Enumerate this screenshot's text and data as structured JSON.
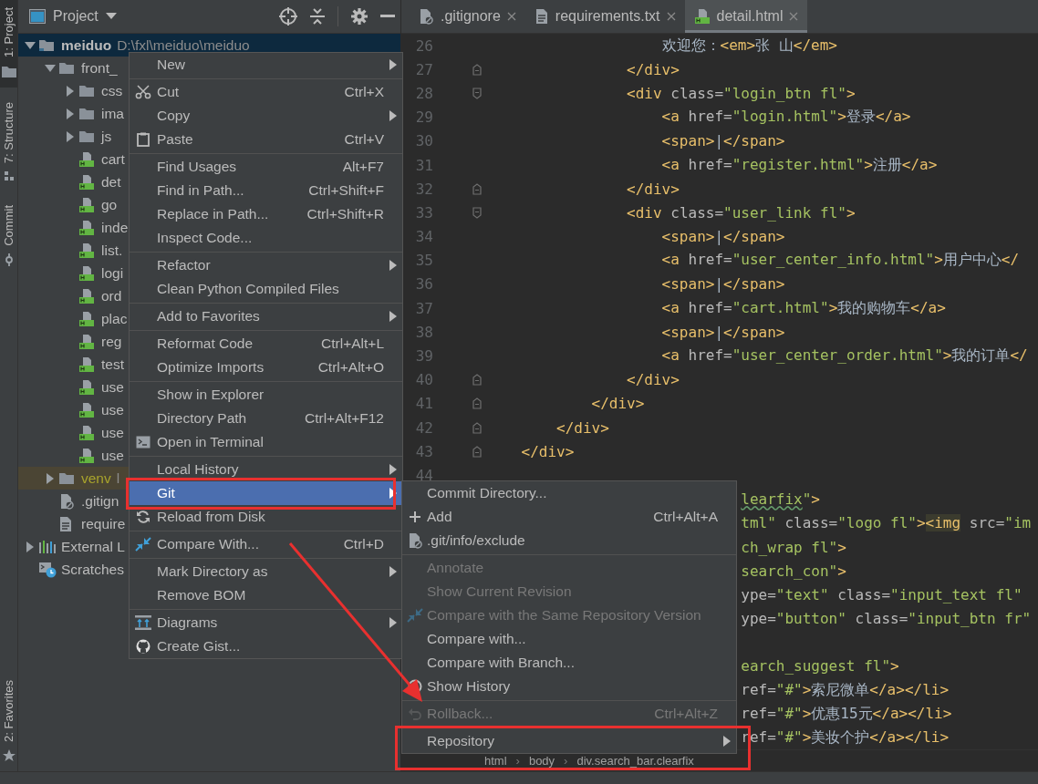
{
  "tool_strip": {
    "top": [
      {
        "label": "1: Project",
        "kind": "folder",
        "selected": true
      },
      {
        "label": "7: Structure",
        "kind": "structure",
        "selected": false
      },
      {
        "label": "Commit",
        "kind": "commit",
        "selected": false
      }
    ],
    "bottom": [
      {
        "label": "2: Favorites",
        "kind": "star",
        "selected": false
      }
    ]
  },
  "project_panel": {
    "title": "Project",
    "tree": [
      {
        "label": "meiduo",
        "path": "D:\\fxl\\meiduo\\meiduo",
        "kind": "module",
        "expanded": true,
        "selected": true,
        "children": [
          {
            "label": "front_",
            "kind": "folder",
            "expanded": true,
            "selected": false,
            "children": [
              {
                "label": "css",
                "kind": "folder",
                "expanded": false,
                "selected": false
              },
              {
                "label": "ima",
                "kind": "folder",
                "expanded": false,
                "selected": false
              },
              {
                "label": "js",
                "kind": "folder",
                "expanded": false,
                "selected": false
              },
              {
                "label": "cart",
                "kind": "html",
                "selected": false
              },
              {
                "label": "det",
                "kind": "html",
                "selected": false
              },
              {
                "label": "go",
                "kind": "html",
                "selected": false
              },
              {
                "label": "inde",
                "kind": "html",
                "selected": false
              },
              {
                "label": "list.",
                "kind": "html",
                "selected": false
              },
              {
                "label": "logi",
                "kind": "html",
                "selected": false
              },
              {
                "label": "ord",
                "kind": "html",
                "selected": false
              },
              {
                "label": "plac",
                "kind": "html",
                "selected": false
              },
              {
                "label": "reg",
                "kind": "html",
                "selected": false
              },
              {
                "label": "test",
                "kind": "html",
                "selected": false
              },
              {
                "label": "use",
                "kind": "html",
                "selected": false
              },
              {
                "label": "use",
                "kind": "html",
                "selected": false
              },
              {
                "label": "use",
                "kind": "html",
                "selected": false
              },
              {
                "label": "use",
                "kind": "html",
                "selected": false
              }
            ]
          },
          {
            "label": "venv",
            "path": "l",
            "kind": "excluded",
            "expanded": false,
            "selected": false
          },
          {
            "label": ".gitign",
            "kind": "ignored",
            "selected": false
          },
          {
            "label": "require",
            "kind": "text",
            "selected": false
          }
        ]
      },
      {
        "label": "External L",
        "kind": "library",
        "expanded": false,
        "selected": false
      },
      {
        "label": "Scratches",
        "kind": "scratches",
        "selected": false
      }
    ]
  },
  "editor": {
    "tabs": [
      {
        "label": ".gitignore",
        "kind": "ignored",
        "selected": false
      },
      {
        "label": "requirements.txt",
        "kind": "text",
        "selected": false
      },
      {
        "label": "detail.html",
        "kind": "html",
        "selected": true
      }
    ],
    "lines": [
      {
        "number": "26",
        "tokens": [
          {
            "kind": "text",
            "text": "欢迎您："
          },
          {
            "kind": "tag",
            "text": "<em>"
          },
          {
            "kind": "text",
            "text": "张 山"
          },
          {
            "kind": "tag",
            "text": "</em>"
          }
        ]
      },
      {
        "number": "27",
        "kind": "fold-end",
        "tokens": [
          {
            "kind": "tag",
            "text": "</div>"
          }
        ]
      },
      {
        "number": "28",
        "kind": "fold-start",
        "tokens": [
          {
            "kind": "tag",
            "text": "<div"
          },
          {
            "kind": "attr",
            "text": " class="
          },
          {
            "kind": "value",
            "text": "\"login_btn fl\""
          },
          {
            "kind": "tag",
            "text": ">"
          }
        ]
      },
      {
        "number": "29",
        "tokens": [
          {
            "kind": "tag",
            "text": "<a"
          },
          {
            "kind": "attr",
            "text": " href="
          },
          {
            "kind": "value",
            "text": "\"login.html\""
          },
          {
            "kind": "tag",
            "text": ">"
          },
          {
            "kind": "text",
            "text": "登录"
          },
          {
            "kind": "tag",
            "text": "</a>"
          }
        ]
      },
      {
        "number": "30",
        "tokens": [
          {
            "kind": "tag",
            "text": "<span>"
          },
          {
            "kind": "text",
            "text": "|"
          },
          {
            "kind": "tag",
            "text": "</span>"
          }
        ]
      },
      {
        "number": "31",
        "tokens": [
          {
            "kind": "tag",
            "text": "<a"
          },
          {
            "kind": "attr",
            "text": " href="
          },
          {
            "kind": "value",
            "text": "\"register.html\""
          },
          {
            "kind": "tag",
            "text": ">"
          },
          {
            "kind": "text",
            "text": "注册"
          },
          {
            "kind": "tag",
            "text": "</a>"
          }
        ]
      },
      {
        "number": "32",
        "kind": "fold-end",
        "tokens": [
          {
            "kind": "tag",
            "text": "</div>"
          }
        ]
      },
      {
        "number": "33",
        "kind": "fold-start",
        "tokens": [
          {
            "kind": "tag",
            "text": "<div"
          },
          {
            "kind": "attr",
            "text": " class="
          },
          {
            "kind": "value",
            "text": "\"user_link fl\""
          },
          {
            "kind": "tag",
            "text": ">"
          }
        ]
      },
      {
        "number": "34",
        "tokens": [
          {
            "kind": "tag",
            "text": "<span>"
          },
          {
            "kind": "text",
            "text": "|"
          },
          {
            "kind": "tag",
            "text": "</span>"
          }
        ]
      },
      {
        "number": "35",
        "tokens": [
          {
            "kind": "tag",
            "text": "<a"
          },
          {
            "kind": "attr",
            "text": " href="
          },
          {
            "kind": "value",
            "text": "\"user_center_info.html\""
          },
          {
            "kind": "tag",
            "text": ">"
          },
          {
            "kind": "text",
            "text": "用户中心"
          },
          {
            "kind": "tag",
            "text": "</"
          }
        ]
      },
      {
        "number": "36",
        "tokens": [
          {
            "kind": "tag",
            "text": "<span>"
          },
          {
            "kind": "text",
            "text": "|"
          },
          {
            "kind": "tag",
            "text": "</span>"
          }
        ]
      },
      {
        "number": "37",
        "tokens": [
          {
            "kind": "tag",
            "text": "<a"
          },
          {
            "kind": "attr",
            "text": " href="
          },
          {
            "kind": "value",
            "text": "\"cart.html\""
          },
          {
            "kind": "tag",
            "text": ">"
          },
          {
            "kind": "text",
            "text": "我的购物车"
          },
          {
            "kind": "tag",
            "text": "</a>"
          }
        ]
      },
      {
        "number": "38",
        "tokens": [
          {
            "kind": "tag",
            "text": "<span>"
          },
          {
            "kind": "text",
            "text": "|"
          },
          {
            "kind": "tag",
            "text": "</span>"
          }
        ]
      },
      {
        "number": "39",
        "tokens": [
          {
            "kind": "tag",
            "text": "<a"
          },
          {
            "kind": "attr",
            "text": " href="
          },
          {
            "kind": "value",
            "text": "\"user_center_order.html\""
          },
          {
            "kind": "tag",
            "text": ">"
          },
          {
            "kind": "text",
            "text": "我的订单"
          },
          {
            "kind": "tag",
            "text": "</"
          }
        ]
      },
      {
        "number": "40",
        "kind": "fold-end",
        "tokens": [
          {
            "kind": "tag",
            "text": "</div>"
          }
        ]
      },
      {
        "number": "41",
        "kind": "fold-end",
        "tokens": [
          {
            "kind": "tag",
            "text": "</div>"
          }
        ]
      },
      {
        "number": "42",
        "kind": "fold-end",
        "tokens": [
          {
            "kind": "tag",
            "text": "</div>"
          }
        ]
      },
      {
        "number": "43",
        "kind": "fold-end",
        "tokens": [
          {
            "kind": "tag",
            "text": "</div>"
          }
        ]
      },
      {
        "number": "44"
      },
      {
        "tokens": [
          {
            "kind": "typo",
            "text": "learfix"
          },
          {
            "kind": "value",
            "text": "\""
          },
          {
            "kind": "tag",
            "text": ">"
          }
        ]
      },
      {
        "tokens": [
          {
            "kind": "value",
            "text": "tml\""
          },
          {
            "kind": "attr",
            "text": " class="
          },
          {
            "kind": "value",
            "text": "\"logo fl\""
          },
          {
            "kind": "tag",
            "text": ">"
          },
          {
            "kind": "match",
            "text": "<img"
          },
          {
            "kind": "attr",
            "text": " src="
          },
          {
            "kind": "value",
            "text": "\"im"
          }
        ]
      },
      {
        "tokens": [
          {
            "kind": "value",
            "text": "ch_wrap fl\""
          },
          {
            "kind": "tag",
            "text": ">"
          }
        ]
      },
      {
        "tokens": [
          {
            "kind": "value",
            "text": "search_con\""
          },
          {
            "kind": "tag",
            "text": ">"
          }
        ]
      },
      {
        "tokens": [
          {
            "kind": "attr",
            "text": "ype="
          },
          {
            "kind": "value",
            "text": "\"text\""
          },
          {
            "kind": "attr",
            "text": " class="
          },
          {
            "kind": "value",
            "text": "\"input_text fl\""
          }
        ]
      },
      {
        "tokens": [
          {
            "kind": "attr",
            "text": "ype="
          },
          {
            "kind": "value",
            "text": "\"button\""
          },
          {
            "kind": "attr",
            "text": " class="
          },
          {
            "kind": "value",
            "text": "\"input_btn fr\""
          }
        ]
      },
      {
        "kind": "blank"
      },
      {
        "tokens": [
          {
            "kind": "value",
            "text": "earch_suggest fl\""
          },
          {
            "kind": "tag",
            "text": ">"
          }
        ]
      },
      {
        "tokens": [
          {
            "kind": "attr",
            "text": "ref="
          },
          {
            "kind": "value",
            "text": "\"#\""
          },
          {
            "kind": "tag",
            "text": ">"
          },
          {
            "kind": "text",
            "text": "索尼微单"
          },
          {
            "kind": "tag",
            "text": "</a></li>"
          }
        ]
      },
      {
        "tokens": [
          {
            "kind": "attr",
            "text": "ref="
          },
          {
            "kind": "value",
            "text": "\"#\""
          },
          {
            "kind": "tag",
            "text": ">"
          },
          {
            "kind": "text",
            "text": "优惠15元"
          },
          {
            "kind": "tag",
            "text": "</a></li>"
          }
        ]
      },
      {
        "tokens": [
          {
            "kind": "attr",
            "text": "ref="
          },
          {
            "kind": "value",
            "text": "\"#\""
          },
          {
            "kind": "tag",
            "text": ">"
          },
          {
            "kind": "text",
            "text": "美妆个护"
          },
          {
            "kind": "tag",
            "text": "</a></li>"
          }
        ]
      }
    ],
    "breadcrumbs": [
      {
        "kind": "crumb",
        "text": "html"
      },
      {
        "kind": "sep",
        "text": "›"
      },
      {
        "kind": "crumb",
        "text": "body"
      },
      {
        "kind": "sep",
        "text": "›"
      },
      {
        "kind": "crumb",
        "text": "div.search_bar.clearfix"
      }
    ]
  },
  "context_menu": {
    "groups": [
      [
        {
          "label": "New",
          "submenu": true,
          "selected": false,
          "outlined": false
        }
      ],
      [
        {
          "label": "Cut",
          "kind": "scissors",
          "shortcut": "Ctrl+X",
          "submenu": false,
          "selected": false,
          "outlined": false
        },
        {
          "label": "Copy",
          "submenu": true,
          "selected": false,
          "outlined": false
        },
        {
          "label": "Paste",
          "kind": "clipboard",
          "shortcut": "Ctrl+V",
          "submenu": false,
          "selected": false,
          "outlined": false
        }
      ],
      [
        {
          "label": "Find Usages",
          "shortcut": "Alt+F7",
          "submenu": false,
          "selected": false,
          "outlined": false
        },
        {
          "label": "Find in Path...",
          "shortcut": "Ctrl+Shift+F",
          "submenu": false,
          "selected": false,
          "outlined": false
        },
        {
          "label": "Replace in Path...",
          "shortcut": "Ctrl+Shift+R",
          "submenu": false,
          "selected": false,
          "outlined": false
        },
        {
          "label": "Inspect Code...",
          "submenu": false,
          "selected": false,
          "outlined": false
        }
      ],
      [
        {
          "label": "Refactor",
          "submenu": true,
          "selected": false,
          "outlined": false
        },
        {
          "label": "Clean Python Compiled Files",
          "submenu": false,
          "selected": false,
          "outlined": false
        }
      ],
      [
        {
          "label": "Add to Favorites",
          "submenu": true,
          "selected": false,
          "outlined": false
        }
      ],
      [
        {
          "label": "Reformat Code",
          "shortcut": "Ctrl+Alt+L",
          "submenu": false,
          "selected": false,
          "outlined": false
        },
        {
          "label": "Optimize Imports",
          "shortcut": "Ctrl+Alt+O",
          "submenu": false,
          "selected": false,
          "outlined": false
        }
      ],
      [
        {
          "label": "Show in Explorer",
          "submenu": false,
          "selected": false,
          "outlined": false
        },
        {
          "label": "Directory Path",
          "shortcut": "Ctrl+Alt+F12",
          "submenu": false,
          "selected": false,
          "outlined": false
        },
        {
          "label": "Open in Terminal",
          "kind": "terminal",
          "submenu": false,
          "selected": false,
          "outlined": false
        }
      ],
      [
        {
          "label": "Local History",
          "submenu": true,
          "selected": false,
          "outlined": false
        },
        {
          "label": "Git",
          "submenu": true,
          "selected": true,
          "outlined": true
        },
        {
          "label": "Reload from Disk",
          "kind": "reload",
          "submenu": false,
          "selected": false,
          "outlined": false
        }
      ],
      [
        {
          "label": "Compare With...",
          "kind": "compare",
          "shortcut": "Ctrl+D",
          "submenu": false,
          "selected": false,
          "outlined": false
        }
      ],
      [
        {
          "label": "Mark Directory as",
          "submenu": true,
          "selected": false,
          "outlined": false
        },
        {
          "label": "Remove BOM",
          "submenu": false,
          "selected": false,
          "outlined": false
        }
      ],
      [
        {
          "label": "Diagrams",
          "kind": "diagram",
          "submenu": true,
          "selected": false,
          "outlined": false
        },
        {
          "label": "Create Gist...",
          "kind": "gist",
          "submenu": false,
          "selected": false,
          "outlined": false
        }
      ]
    ]
  },
  "git_submenu": {
    "groups": [
      [
        {
          "label": "Commit Directory...",
          "submenu": false,
          "disabled": false,
          "selected": false,
          "outlined": false
        },
        {
          "label": "Add",
          "kind": "plus",
          "shortcut": "Ctrl+Alt+A",
          "submenu": false,
          "disabled": false,
          "selected": false,
          "outlined": false
        },
        {
          "label": ".git/info/exclude",
          "kind": "ignored",
          "submenu": false,
          "disabled": false,
          "selected": false,
          "outlined": false
        }
      ],
      [
        {
          "label": "Annotate",
          "submenu": false,
          "disabled": true,
          "selected": false,
          "outlined": false
        },
        {
          "label": "Show Current Revision",
          "submenu": false,
          "disabled": true,
          "selected": false,
          "outlined": false
        },
        {
          "label": "Compare with the Same Repository Version",
          "kind": "compare",
          "submenu": false,
          "disabled": true,
          "selected": false,
          "outlined": false
        },
        {
          "label": "Compare with...",
          "submenu": false,
          "disabled": false,
          "selected": false,
          "outlined": false
        },
        {
          "label": "Compare with Branch...",
          "submenu": false,
          "disabled": false,
          "selected": false,
          "outlined": false
        },
        {
          "label": "Show History",
          "kind": "history",
          "submenu": false,
          "disabled": false,
          "selected": false,
          "outlined": false
        }
      ],
      [
        {
          "label": "Rollback...",
          "kind": "undo",
          "shortcut": "Ctrl+Alt+Z",
          "submenu": false,
          "disabled": true,
          "selected": false,
          "outlined": false
        }
      ],
      [
        {
          "label": "Repository",
          "submenu": true,
          "disabled": false,
          "selected": false,
          "outlined": true
        }
      ]
    ]
  },
  "annotation_arrow": true
}
